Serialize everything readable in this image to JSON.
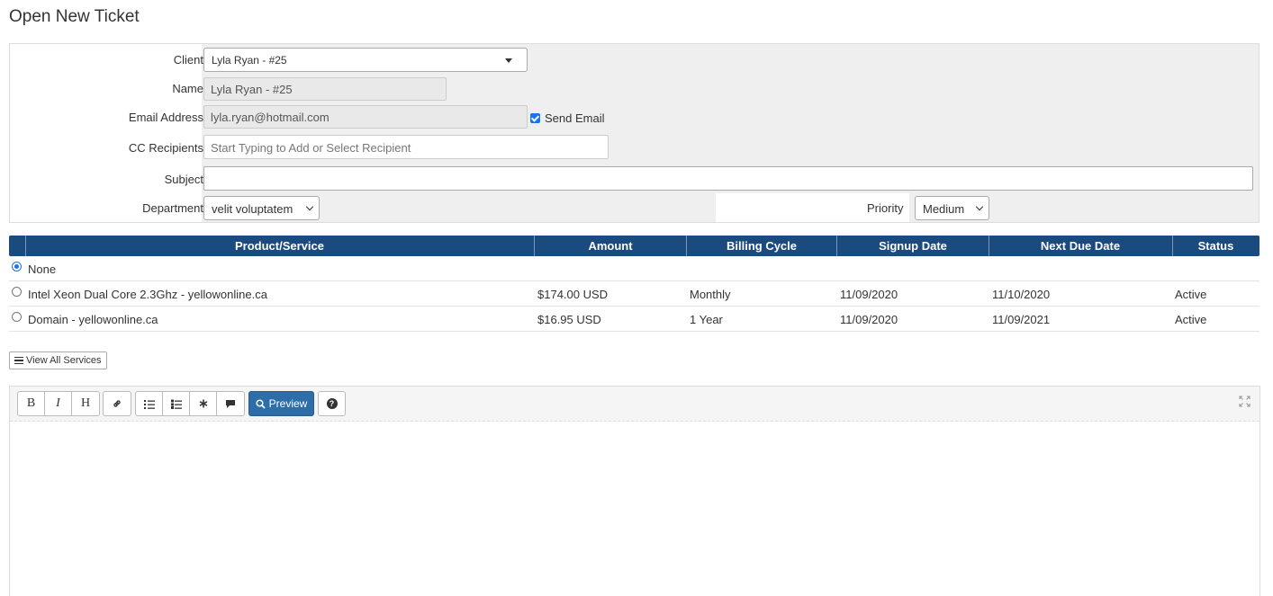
{
  "page": {
    "title": "Open New Ticket"
  },
  "form": {
    "client": {
      "label": "Client",
      "value": "Lyla Ryan - #25"
    },
    "name": {
      "label": "Name",
      "value": "Lyla Ryan - #25"
    },
    "email": {
      "label": "Email Address",
      "value": "lyla.ryan@hotmail.com",
      "send_email_label": "Send Email",
      "send_email_checked": true
    },
    "cc": {
      "label": "CC Recipients",
      "placeholder": "Start Typing to Add or Select Recipient"
    },
    "subject": {
      "label": "Subject",
      "value": ""
    },
    "department": {
      "label": "Department",
      "value": "velit voluptatem"
    },
    "priority": {
      "label": "Priority",
      "value": "Medium"
    }
  },
  "services": {
    "headers": [
      "Product/Service",
      "Amount",
      "Billing Cycle",
      "Signup Date",
      "Next Due Date",
      "Status"
    ],
    "none_label": "None",
    "rows": [
      {
        "product": "Intel Xeon Dual Core 2.3Ghz - yellowonline.ca",
        "amount": "$174.00 USD",
        "cycle": "Monthly",
        "signup": "11/09/2020",
        "due": "11/10/2020",
        "status": "Active"
      },
      {
        "product": "Domain - yellowonline.ca",
        "amount": "$16.95 USD",
        "cycle": "1 Year",
        "signup": "11/09/2020",
        "due": "11/09/2021",
        "status": "Active"
      }
    ],
    "view_all_label": "View All Services"
  },
  "editor": {
    "toolbar": {
      "bold": "B",
      "italic": "I",
      "heading": "H",
      "preview_label": "Preview"
    }
  },
  "colors": {
    "header_bg": "#1a4a7e",
    "preview_bg": "#2d6ea8",
    "field_bg": "#efefef"
  }
}
